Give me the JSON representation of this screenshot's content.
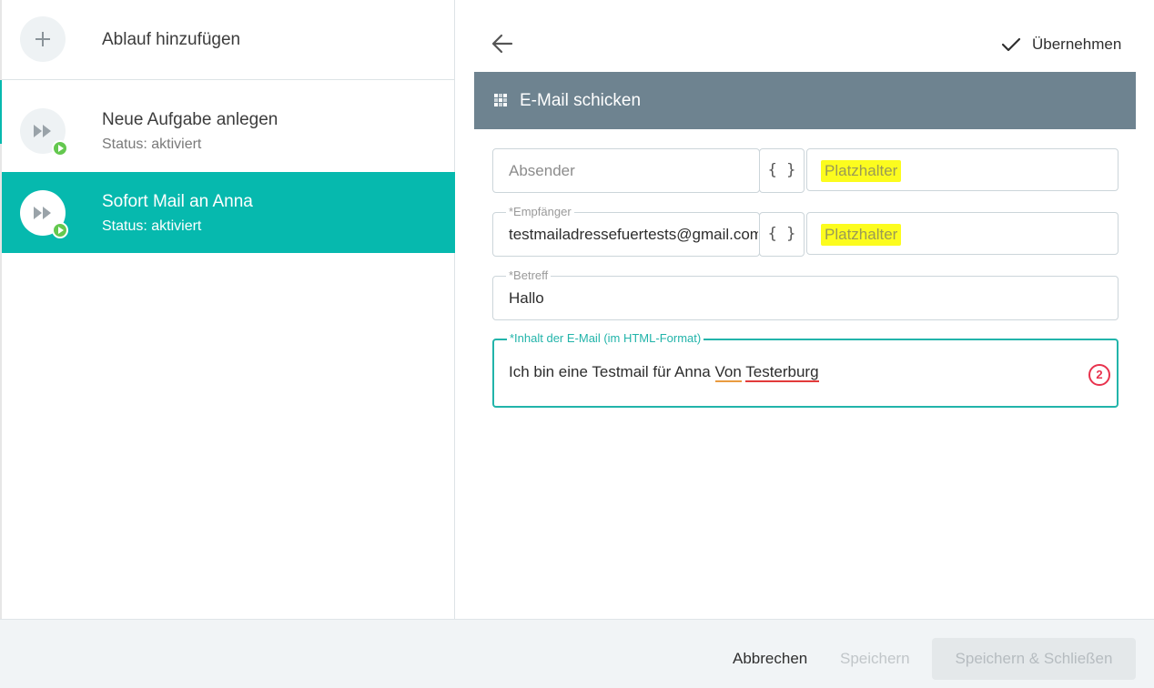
{
  "sidebar": {
    "add_flow_label": "Ablauf hinzufügen",
    "items": [
      {
        "title": "Neue Aufgabe anlegen",
        "status": "Status: aktiviert",
        "selected": false
      },
      {
        "title": "Sofort Mail an Anna",
        "status": "Status: aktiviert",
        "selected": true
      }
    ]
  },
  "toolbar": {
    "apply_label": "Übernehmen"
  },
  "section": {
    "title": "E-Mail schicken"
  },
  "form": {
    "sender": {
      "placeholder": "Absender",
      "placeholder_button": "{ }",
      "placeholder_field": "Platzhalter"
    },
    "recipient": {
      "label": "*Empfänger",
      "value": "testmailadressefuertests@gmail.com",
      "placeholder_button": "{ }",
      "placeholder_field": "Platzhalter"
    },
    "subject": {
      "label": "*Betreff",
      "value": "Hallo"
    },
    "content": {
      "label": "*Inhalt der E-Mail (im HTML-Format)",
      "value_prefix": "Ich bin eine Testmail für Anna ",
      "value_word1": "Von",
      "value_space": " ",
      "value_word2": "Testerburg",
      "error_count": "2"
    }
  },
  "footer": {
    "cancel_label": "Abbrechen",
    "save_label": "Speichern",
    "save_close_label": "Speichern & Schließen"
  },
  "colors": {
    "accent": "#06b9ae",
    "header": "#6e8390",
    "highlight": "#fcfc1e",
    "error": "#e8324d",
    "badge": "#64c84f"
  }
}
